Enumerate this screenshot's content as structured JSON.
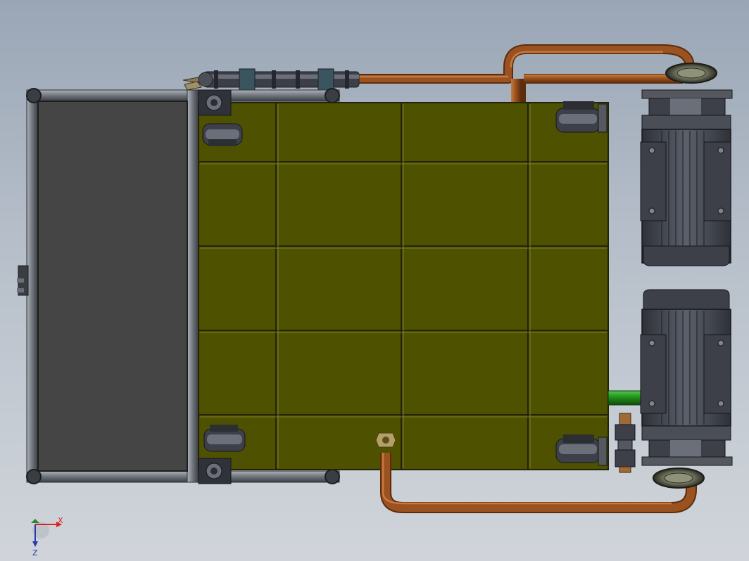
{
  "viewport": {
    "background": "cad-gradient",
    "colors": {
      "deck": "#4e5200",
      "deck_edge": "#22240a",
      "frame": "#7f848c",
      "frame_dark": "#2b2e33",
      "panel": "#454545",
      "motor_body": "#3d4049",
      "motor_light": "#6a6f7a",
      "pipe": "#8e4a17",
      "pipe_highlight": "#c0743a",
      "coupling": "#4b4f42",
      "pipe_green": "#23921f",
      "brass": "#b07840",
      "axis_x": "#d22",
      "axis_y": "#2a3aa8",
      "axis_z": "#2a3aa8"
    }
  },
  "triad": {
    "x_label": "X",
    "z_label": "Z"
  }
}
